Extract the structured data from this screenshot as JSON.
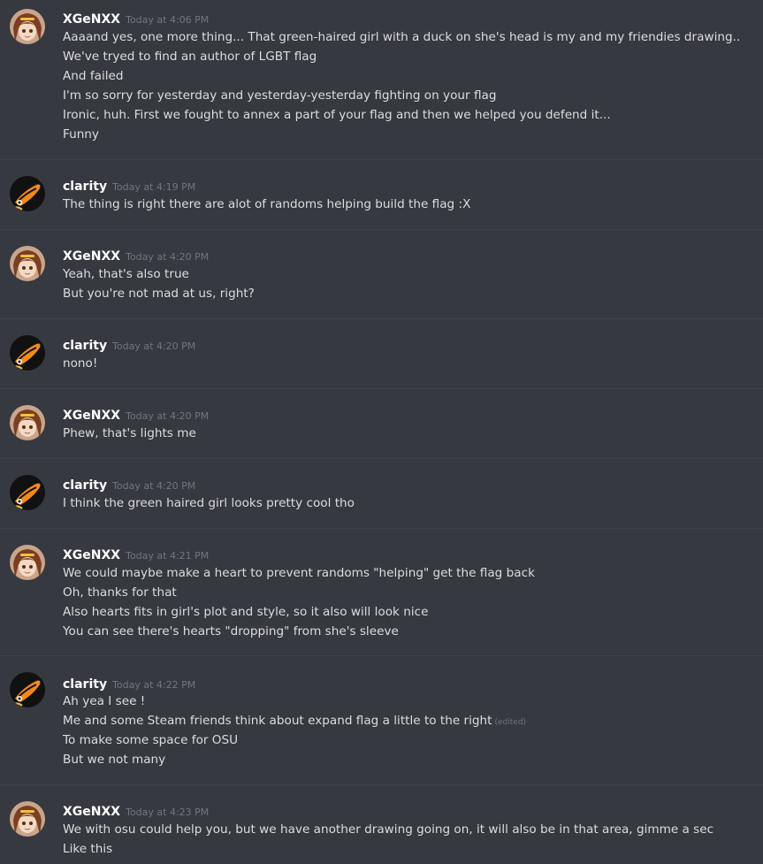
{
  "messages": [
    {
      "author": "XGeNXX",
      "avatar_icon": "anime-girl-avatar-icon",
      "timestamp": "Today at 4:06 PM",
      "lines": [
        "Aaaand yes, one more thing... That green-haired girl with a duck on she's head is my and my friendies drawing..",
        "We've tryed to find an author of LGBT flag",
        "And failed",
        "I'm so sorry for yesterday and yesterday-yesterday fighting on your flag",
        "Ironic, huh. First we fought to annex a part of your flag and then we helped you defend it...",
        "Funny"
      ]
    },
    {
      "author": "clarity",
      "avatar_icon": "toucan-avatar-icon",
      "timestamp": "Today at 4:19 PM",
      "lines": [
        "The thing is right there are alot of randoms helping build the flag :X"
      ]
    },
    {
      "author": "XGeNXX",
      "avatar_icon": "anime-girl-avatar-icon",
      "timestamp": "Today at 4:20 PM",
      "lines": [
        "Yeah, that's also true",
        "But you're not mad at us, right?"
      ]
    },
    {
      "author": "clarity",
      "avatar_icon": "toucan-avatar-icon",
      "timestamp": "Today at 4:20 PM",
      "lines": [
        "nono!"
      ]
    },
    {
      "author": "XGeNXX",
      "avatar_icon": "anime-girl-avatar-icon",
      "timestamp": "Today at 4:20 PM",
      "lines": [
        "Phew, that's lights me"
      ]
    },
    {
      "author": "clarity",
      "avatar_icon": "toucan-avatar-icon",
      "timestamp": "Today at 4:20 PM",
      "lines": [
        "I think the green haired girl looks pretty cool tho"
      ]
    },
    {
      "author": "XGeNXX",
      "avatar_icon": "anime-girl-avatar-icon",
      "timestamp": "Today at 4:21 PM",
      "lines": [
        "We could maybe make a heart to prevent randoms \"helping\" get the flag back",
        "Oh, thanks for that",
        "Also hearts fits in girl's plot and style, so it also will look nice",
        "You can see there's hearts \"dropping\" from she's sleeve"
      ]
    },
    {
      "author": "clarity",
      "avatar_icon": "toucan-avatar-icon",
      "timestamp": "Today at 4:22 PM",
      "lines": [
        "Ah yea I see !",
        "Me and some Steam friends think about expand flag a little to the right",
        "To make some space for OSU",
        "But we not many"
      ],
      "edited_label": "(edited)"
    },
    {
      "author": "XGeNXX",
      "avatar_icon": "anime-girl-avatar-icon",
      "timestamp": "Today at 4:23 PM",
      "lines": [
        "We with osu could help you, but we have another drawing going on, it will also be in that area, gimme a sec",
        "Like this"
      ]
    }
  ],
  "colors": {
    "background": "#36393f",
    "username": "#ffffff",
    "timestamp": "#72767d",
    "message_text": "#dcddde",
    "divider": "#3f4248"
  }
}
